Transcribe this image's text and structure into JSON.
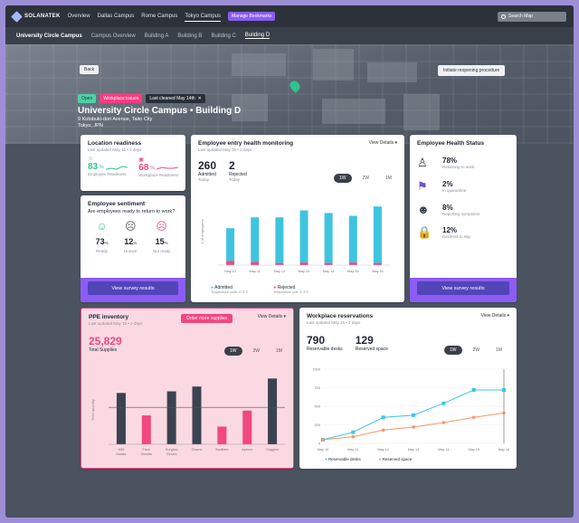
{
  "nav": {
    "brand": "SOLANATEK",
    "links": [
      "Overview",
      "Dallas Campus",
      "Rome Campus",
      "Tokyo Campus"
    ],
    "active_index": 3,
    "manage": "Manage Bookmarks",
    "search": "Search Map"
  },
  "subnav": {
    "items": [
      "University Circle Campus",
      "Campus Overview",
      "Building A",
      "Building B",
      "Building C",
      "Building D"
    ]
  },
  "hero": {
    "back": "Back",
    "reopen": "Initiate reopening procedure",
    "badge_open": "Open",
    "badge_issues": "Workplace issues",
    "badge_cleaned": "Last cleaned May 14th",
    "title": "University Circle Campus • Building D",
    "address1": "9 Kotobuki-dori Avenue, Taito City",
    "address2": "Tokyo, JPN"
  },
  "readiness": {
    "title": "Location readiness",
    "sub": "Last updated May 15 • 2 days",
    "emp_value": "83",
    "emp_unit": "%",
    "emp_label": "Employee Readiness",
    "work_value": "68",
    "work_unit": "%",
    "work_label": "Workplace Readiness"
  },
  "sentiment": {
    "title": "Employee sentiment",
    "question": "Are employees ready to return to work?",
    "ready": "73",
    "ready_label": "Ready",
    "unsure": "12",
    "unsure_label": "Unsure",
    "not": "15",
    "not_label": "Not ready",
    "unit": "%",
    "button": "View survey results"
  },
  "entry": {
    "title": "Employee entry health monitoring",
    "sub": "Last updated May 15 • 2 days",
    "view": "View Details",
    "admitted_value": "260",
    "admitted_label": "Admitted",
    "admitted_sub": "Today",
    "rejected_value": "2",
    "rejected_label": "Rejected",
    "rejected_sub": "Today",
    "ranges": [
      "1W",
      "2W",
      "1M"
    ],
    "legend_admitted": "Admitted",
    "legend_admitted_sub": "Temperature under 37.5°C",
    "legend_rejected": "Rejected",
    "legend_rejected_sub": "Temperature over 37.5°C",
    "ylabel": "# of employees"
  },
  "health": {
    "title": "Employee Health Status",
    "items": [
      {
        "value": "78%",
        "label": "Returning to work"
      },
      {
        "value": "2%",
        "label": "In quarantine"
      },
      {
        "value": "8%",
        "label": "Reporting symptoms"
      },
      {
        "value": "12%",
        "label": "Declined to say"
      }
    ],
    "button": "View survey results"
  },
  "ppe": {
    "title": "PPE inventory",
    "sub": "Last updated May 15 • 2 days",
    "order": "Order more supplies",
    "view": "View Details",
    "total": "25,829",
    "total_label": "Total Supplies",
    "ranges": [
      "1W",
      "2W",
      "1M"
    ],
    "ylabel": "Total quantity"
  },
  "reserve": {
    "title": "Workplace reservations",
    "sub": "Last updated May 15 • 2 days",
    "view": "View Details",
    "desks": "790",
    "desks_label": "Reservable desks",
    "space": "129",
    "space_label": "Reserved space",
    "ranges": [
      "1W",
      "2W",
      "1M"
    ],
    "legend1": "Reservable desks",
    "legend2": "Reserved space"
  },
  "colors": {
    "admitted": "#3fc4e0",
    "rejected": "#f0487f",
    "dark": "#3b4350",
    "pink": "#f0487f",
    "line2": "#f5956a"
  },
  "chart_data": [
    {
      "type": "bar",
      "title": "Employee entry health monitoring",
      "categories": [
        "May 10",
        "May 11",
        "May 12",
        "May 13",
        "May 14",
        "May 15",
        "May 16"
      ],
      "series": [
        {
          "name": "Admitted",
          "values": [
            150,
            205,
            210,
            240,
            230,
            215,
            260
          ]
        },
        {
          "name": "Rejected",
          "values": [
            20,
            15,
            10,
            12,
            10,
            12,
            10
          ]
        }
      ],
      "stacked": true,
      "ylim": [
        0,
        300
      ]
    },
    {
      "type": "bar",
      "title": "PPE inventory",
      "categories": [
        "N95 Masks",
        "Face Shields",
        "Surgical Gloves",
        "Gowns",
        "Sanitizer",
        "Aprons",
        "Goggles"
      ],
      "values": [
        16000,
        9000,
        16500,
        18000,
        5500,
        10500,
        20500
      ],
      "reference_line": 11500,
      "ylim": [
        0,
        22000
      ]
    },
    {
      "type": "line",
      "title": "Workplace reservations",
      "x": [
        "May 10",
        "May 11",
        "May 12",
        "May 13",
        "May 14",
        "May 15",
        "May 16"
      ],
      "series": [
        {
          "name": "Reservable desks",
          "values": [
            50,
            150,
            350,
            380,
            540,
            720,
            720
          ]
        },
        {
          "name": "Reserved space",
          "values": [
            50,
            90,
            180,
            220,
            280,
            350,
            410
          ]
        }
      ],
      "yticks": [
        0,
        250,
        500,
        750,
        1000
      ],
      "ylim": [
        0,
        1000
      ]
    }
  ]
}
